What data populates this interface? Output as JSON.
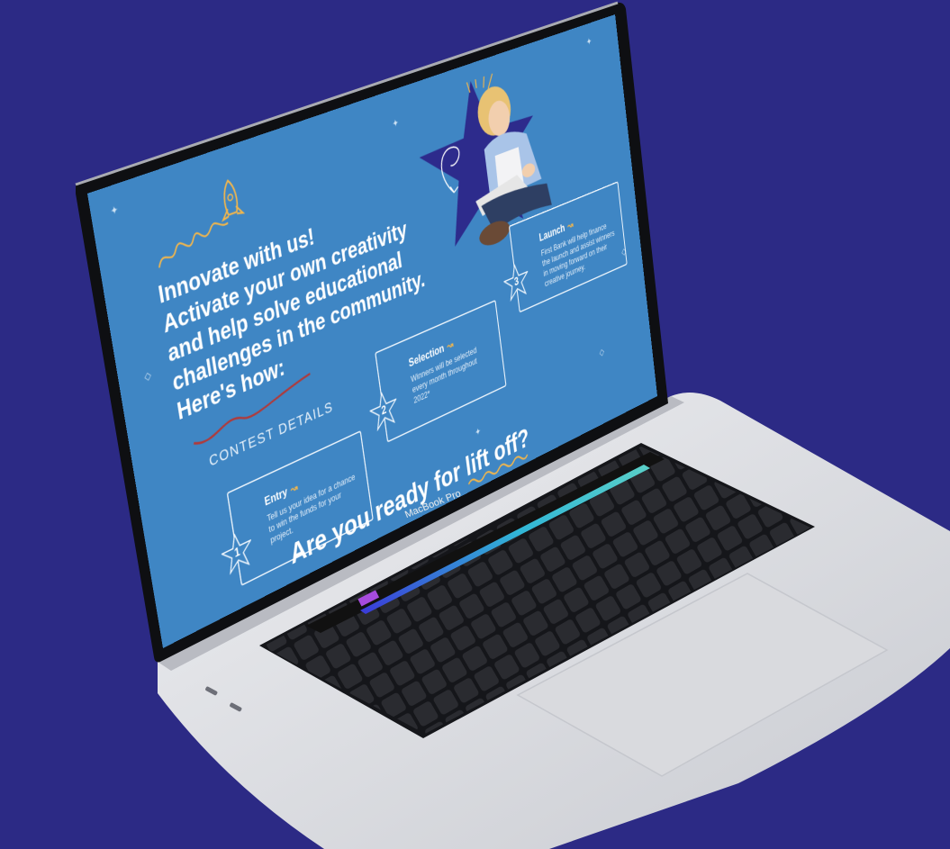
{
  "device": {
    "brand_label": "MacBook Pro"
  },
  "page": {
    "headline": [
      "Innovate with us!",
      "Activate your own creativity",
      "and help solve educational",
      "challenges in the community.",
      "Here's how:"
    ],
    "contest_heading": "CONTEST DETAILS",
    "steps": [
      {
        "number": "1",
        "title": "Entry",
        "description": "Tell us your idea for a chance to win the funds for your project."
      },
      {
        "number": "2",
        "title": "Selection",
        "description": "Winners will be selected every month throughout 2022*"
      },
      {
        "number": "3",
        "title": "Launch",
        "description": "First Bank will help finance the launch and assist winners in moving forward on their creative journey."
      }
    ],
    "cta_prefix": "Are you ready for ",
    "cta_highlight": "lift off?"
  },
  "colors": {
    "background": "#2c2a85",
    "screen_blue": "#3f86c4",
    "star_navy": "#2d2b8c",
    "accent_gold": "#f2b64c",
    "accent_red": "#b03a3a",
    "laptop_silver": "#dcdde1"
  }
}
